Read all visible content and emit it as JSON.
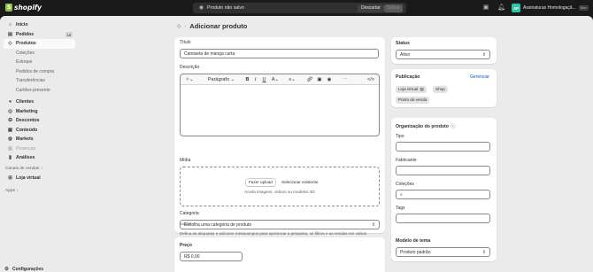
{
  "topbar": {
    "logo_text": "shopify",
    "save_bar": {
      "status": "Produto não salvo",
      "discard_label": "Descartar",
      "save_label": "Salvar"
    },
    "store": {
      "initials": "AP",
      "name": "Assinaturas Homologaçã...",
      "tag": "Dev"
    }
  },
  "sidebar": {
    "items": [
      {
        "label": "Início",
        "icon": "home-icon"
      },
      {
        "label": "Pedidos",
        "icon": "inbox-icon",
        "badge": "18"
      },
      {
        "label": "Produtos",
        "icon": "tag-icon"
      }
    ],
    "product_subitems": [
      "Coleções",
      "Estoque",
      "Pedidos de compra",
      "Transferências",
      "Cartões-presente"
    ],
    "items2": [
      {
        "label": "Clientes",
        "icon": "person-icon"
      },
      {
        "label": "Marketing",
        "icon": "target-icon"
      },
      {
        "label": "Descontos",
        "icon": "discount-icon"
      },
      {
        "label": "Conteúdo",
        "icon": "content-icon"
      },
      {
        "label": "Markets",
        "icon": "globe-icon"
      },
      {
        "label": "Finanças",
        "icon": "bank-icon"
      },
      {
        "label": "Análises",
        "icon": "chart-icon"
      }
    ],
    "sales_channels_label": "Canais de vendas",
    "online_store": "Loja virtual",
    "apps_label": "Apps",
    "settings_label": "Configurações"
  },
  "main": {
    "title": "Adicionar produto",
    "title_field": {
      "label": "Título",
      "value": "Camiseta de manga curta"
    },
    "description": {
      "label": "Descrição",
      "paragraph": "Parágrafo"
    },
    "media": {
      "label": "Mídia",
      "upload": "Fazer upload",
      "select": "Selecionar existente",
      "hint": "Aceita imagens, vídeos ou modelos 3D"
    },
    "category": {
      "label": "Categoria",
      "placeholder": "Escolha uma categoria de produto",
      "help_line1": "Defina as alíquotas e adicione metacampos para aprimorar a pesquisa, os filtros e as vendas em vários",
      "help_line2": "canais."
    },
    "price": {
      "label": "Preço",
      "value": "R$ 0,00"
    }
  },
  "right": {
    "status": {
      "title": "Status",
      "value": "Ativo"
    },
    "publication": {
      "title": "Publicação",
      "manage": "Gerenciar",
      "channels": [
        "Loja virtual",
        "Shop",
        "Ponto de venda"
      ]
    },
    "organization": {
      "title": "Organização do produto",
      "type_label": "Tipo",
      "vendor_label": "Fabricante",
      "collections_label": "Coleções",
      "tags_label": "Tags"
    },
    "theme": {
      "title": "Modelo de tema",
      "value": "Produto padrão"
    }
  }
}
